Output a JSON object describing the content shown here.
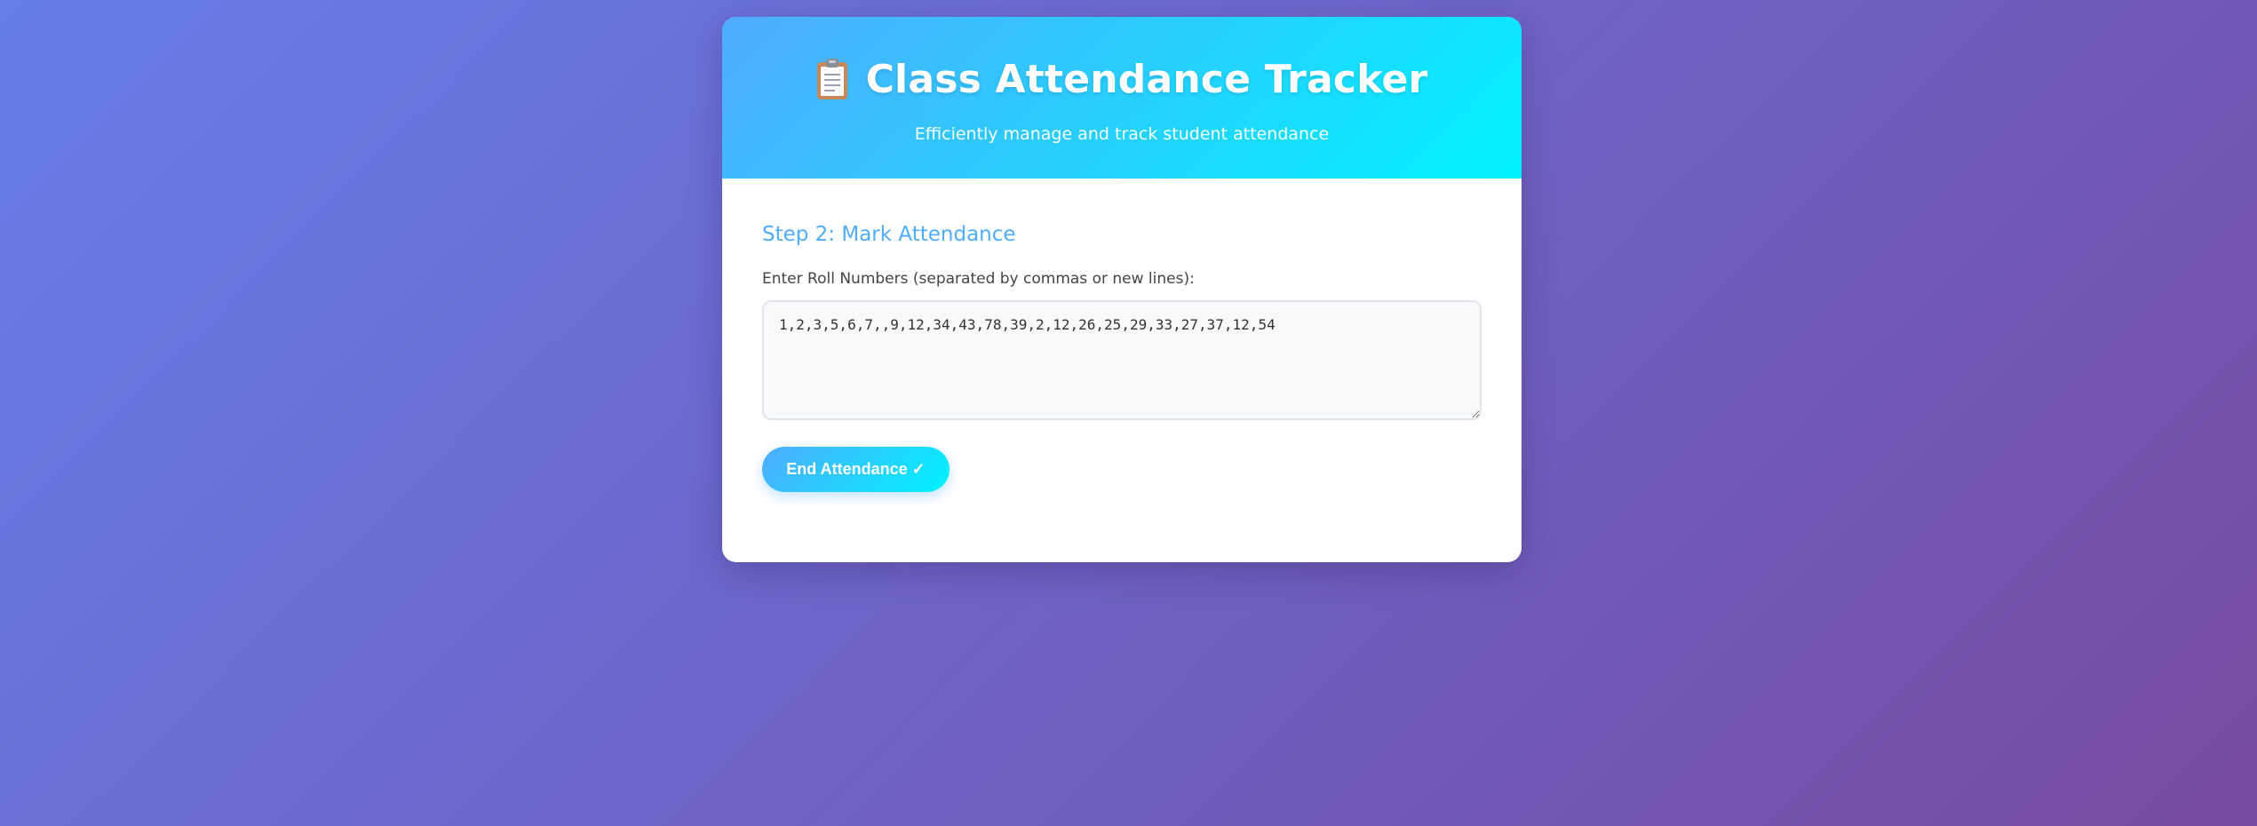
{
  "header": {
    "icon": "clipboard-icon",
    "title": "Class Attendance Tracker",
    "subtitle": "Efficiently manage and track student attendance"
  },
  "main": {
    "step_title": "Step 2: Mark Attendance",
    "roll_numbers_label": "Enter Roll Numbers (separated by commas or new lines):",
    "roll_numbers_value": "1,2,3,5,6,7,,9,12,34,43,78,39,2,12,26,25,29,33,27,37,12,54",
    "end_button_label": "End Attendance ✓"
  },
  "colors": {
    "background_gradient_start": "#667eea",
    "background_gradient_end": "#764ba2",
    "header_gradient_start": "#4facfe",
    "header_gradient_end": "#00f2fe",
    "accent": "#4facfe"
  }
}
